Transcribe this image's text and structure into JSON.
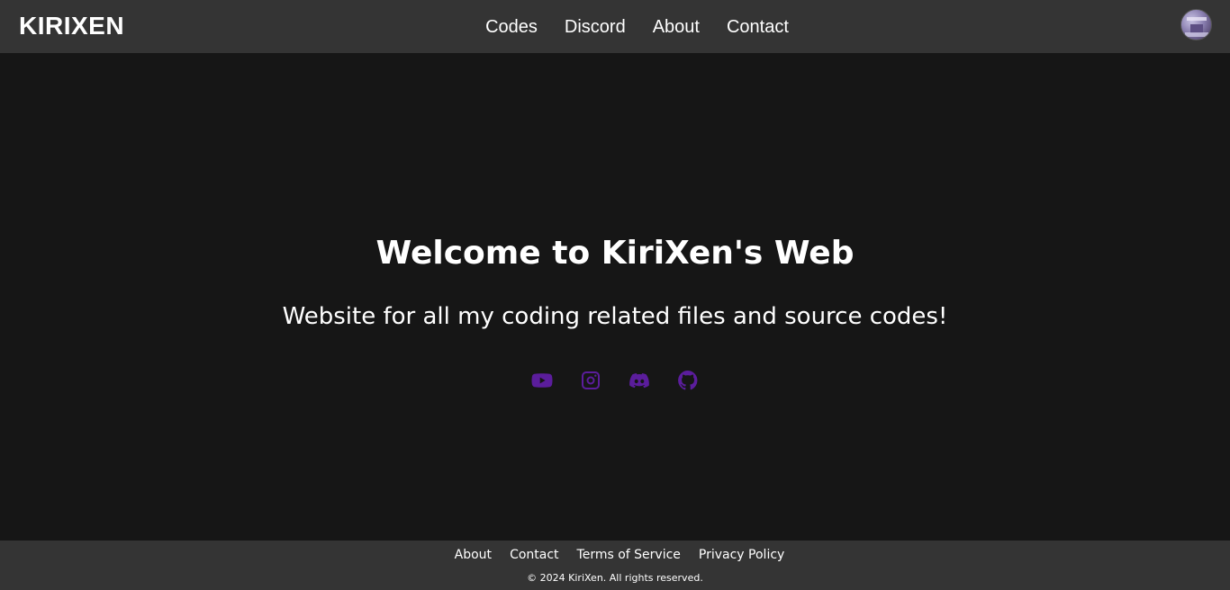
{
  "header": {
    "brand": "KIRIXEN",
    "nav": [
      {
        "label": "Codes"
      },
      {
        "label": "Discord"
      },
      {
        "label": "About"
      },
      {
        "label": "Contact"
      }
    ],
    "avatar_icon": "user-avatar"
  },
  "hero": {
    "title": "Welcome to KiriXen's Web",
    "subtitle": "Website for all my coding related files and source codes!"
  },
  "socials": {
    "accent_color": "#5b1d9c",
    "icons": [
      "youtube-icon",
      "instagram-icon",
      "discord-icon",
      "github-icon"
    ]
  },
  "footer": {
    "links": [
      {
        "label": "About"
      },
      {
        "label": "Contact"
      },
      {
        "label": "Terms of Service"
      },
      {
        "label": "Privacy Policy"
      }
    ],
    "copyright": "© 2024 KiriXen. All rights reserved."
  },
  "colors": {
    "background": "#161616",
    "bar": "#343434",
    "text": "#ffffff"
  }
}
